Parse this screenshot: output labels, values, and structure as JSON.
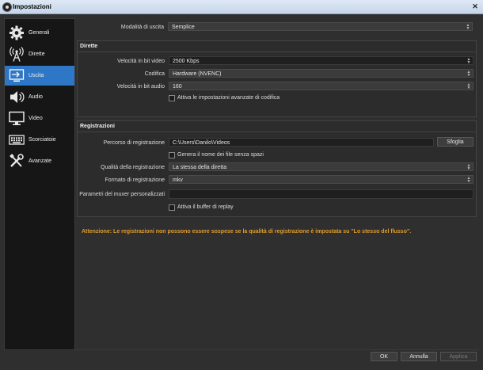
{
  "window": {
    "title": "Impostazioni",
    "close_glyph": "✕"
  },
  "sidebar": {
    "items": [
      {
        "label": "Generali",
        "icon": "gear-icon"
      },
      {
        "label": "Dirette",
        "icon": "broadcast-antenna-icon"
      },
      {
        "label": "Uscita",
        "icon": "output-icon",
        "active": true
      },
      {
        "label": "Audio",
        "icon": "speaker-icon"
      },
      {
        "label": "Video",
        "icon": "monitor-icon"
      },
      {
        "label": "Scorciatoie",
        "icon": "keyboard-icon"
      },
      {
        "label": "Avanzate",
        "icon": "tools-icon"
      }
    ]
  },
  "output_mode": {
    "label": "Modalità di uscita",
    "value": "Semplice"
  },
  "streaming": {
    "title": "Dirette",
    "bitrate_label": "Velocità in bit video",
    "bitrate_value": "2500 Kbps",
    "encoder_label": "Codifica",
    "encoder_value": "Hardware (NVENC)",
    "audio_bitrate_label": "Velocità in bit audio",
    "audio_bitrate_value": "160",
    "advanced_label": "Attiva le impostazioni avanzate di codifica"
  },
  "recording": {
    "title": "Registrazioni",
    "path_label": "Percorso di registrazione",
    "path_value": "C:\\Users\\Danilo\\Videos",
    "browse_label": "Sfoglia",
    "nospace_label": "Genera il nome dei file senza spazi",
    "quality_label": "Qualità della registrazione",
    "quality_value": "La stessa della diretta",
    "format_label": "Formato di registrazione",
    "format_value": "mkv",
    "muxer_label": "Parametri del muxer personalizzati",
    "muxer_value": "",
    "replay_label": "Attiva il buffer di replay"
  },
  "warning": "Attenzione: Le registrazioni non possono essere sospese se la qualità di registrazione è impostata su \"Lo stesso del flusso\".",
  "buttons": {
    "ok": "OK",
    "cancel": "Annulla",
    "apply": "Applica"
  },
  "colors": {
    "accent": "#2e76c6",
    "warning": "#e09b2d"
  }
}
